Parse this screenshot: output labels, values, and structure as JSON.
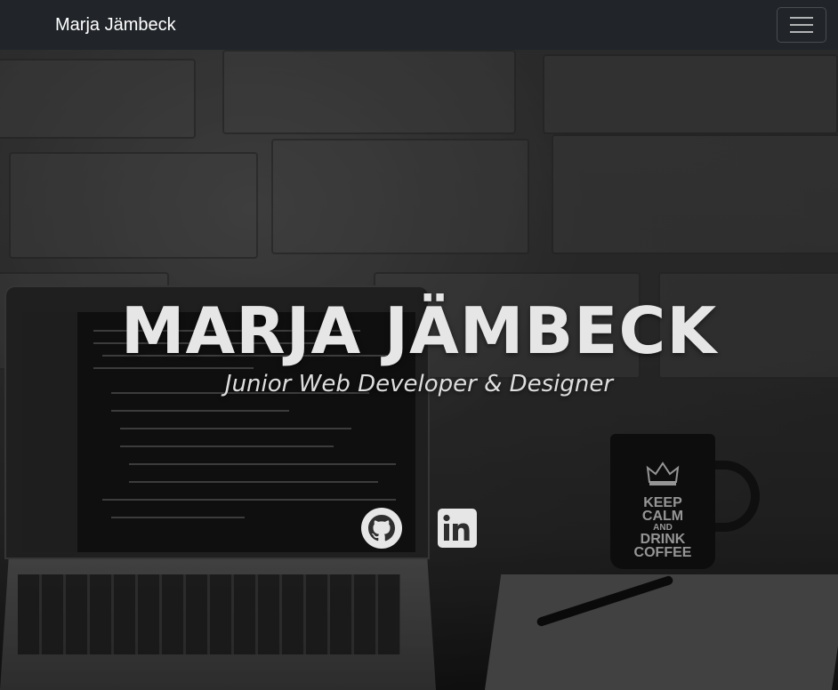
{
  "navbar": {
    "brand": "Marja Jämbeck",
    "toggler_icon": "hamburger-menu-icon"
  },
  "hero": {
    "title": "MARJA JÄMBECK",
    "subtitle": "Junior Web Developer & Designer",
    "background_image_description_icon": "laptop-desk-photo",
    "mug": {
      "line1": "KEEP",
      "line2": "CALM",
      "line3": "AND",
      "line4": "DRINK",
      "line5": "COFFEE"
    }
  },
  "socials": [
    {
      "icon": "github-icon"
    },
    {
      "icon": "linkedin-icon"
    }
  ],
  "colors": {
    "navbar_bg": "#212529",
    "brand_text": "#ffffff",
    "hero_text": "#e6e6e6",
    "icon_color": "#e6e6e6"
  }
}
